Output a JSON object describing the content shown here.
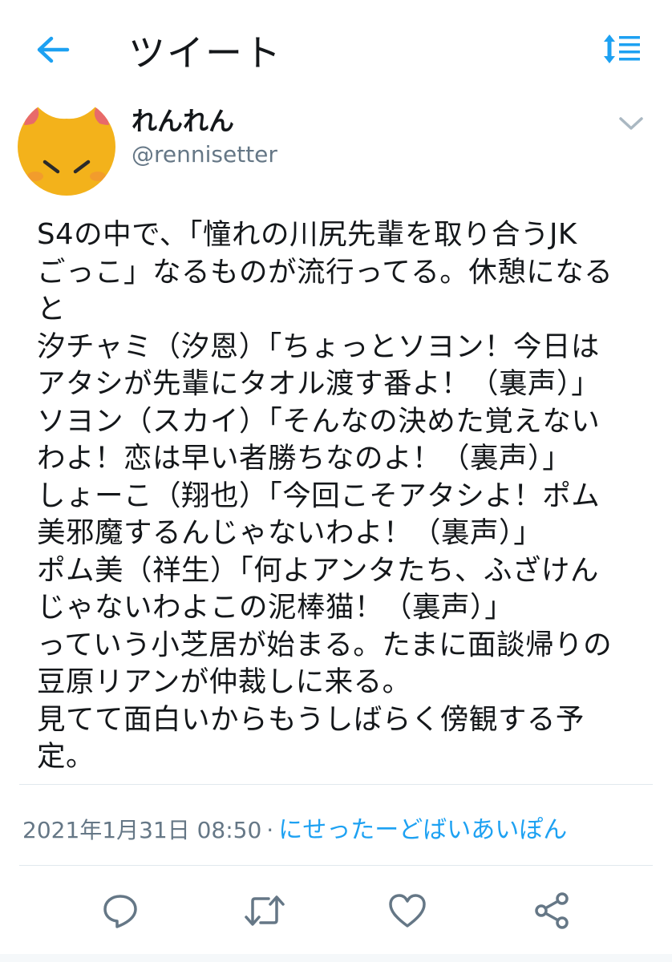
{
  "header": {
    "title": "ツイート",
    "back_icon": "back-arrow-icon",
    "sort_icon": "sort-icon",
    "accent_color": "#1da1f2"
  },
  "author": {
    "display_name": "れんれん",
    "handle": "@rennisetter",
    "avatar_icon": "orange-cat-avatar"
  },
  "tweet": {
    "lines": [
      "S4の中で、「憧れの川尻先輩を取り合うJK",
      "ごっこ」なるものが流行ってる。休憩になる",
      "と",
      "汐チャミ（汐恩）「ちょっとソヨン！今日は",
      "アタシが先輩にタオル渡す番よ！（裏声）」",
      "ソヨン（スカイ）「そんなの決めた覚えない",
      "わよ！恋は早い者勝ちなのよ！（裏声）」",
      "しょーこ（翔也）「今回こそアタシよ！ポム",
      "美邪魔するんじゃないわよ！（裏声）」",
      "ポム美（祥生）「何よアンタたち、ふざけん",
      "じゃないわよこの泥棒猫！（裏声）」",
      "っていう小芝居が始まる。たまに面談帰りの",
      "豆原リアンが仲裁しに来る。",
      "見てて面白いからもうしばらく傍観する予",
      "定。"
    ]
  },
  "meta": {
    "timestamp": "2021年1月31日 08:50",
    "separator": "·",
    "source": "にせったーどばいあいぽん"
  },
  "actions": [
    "reply-icon",
    "retweet-icon",
    "like-icon",
    "share-icon"
  ]
}
